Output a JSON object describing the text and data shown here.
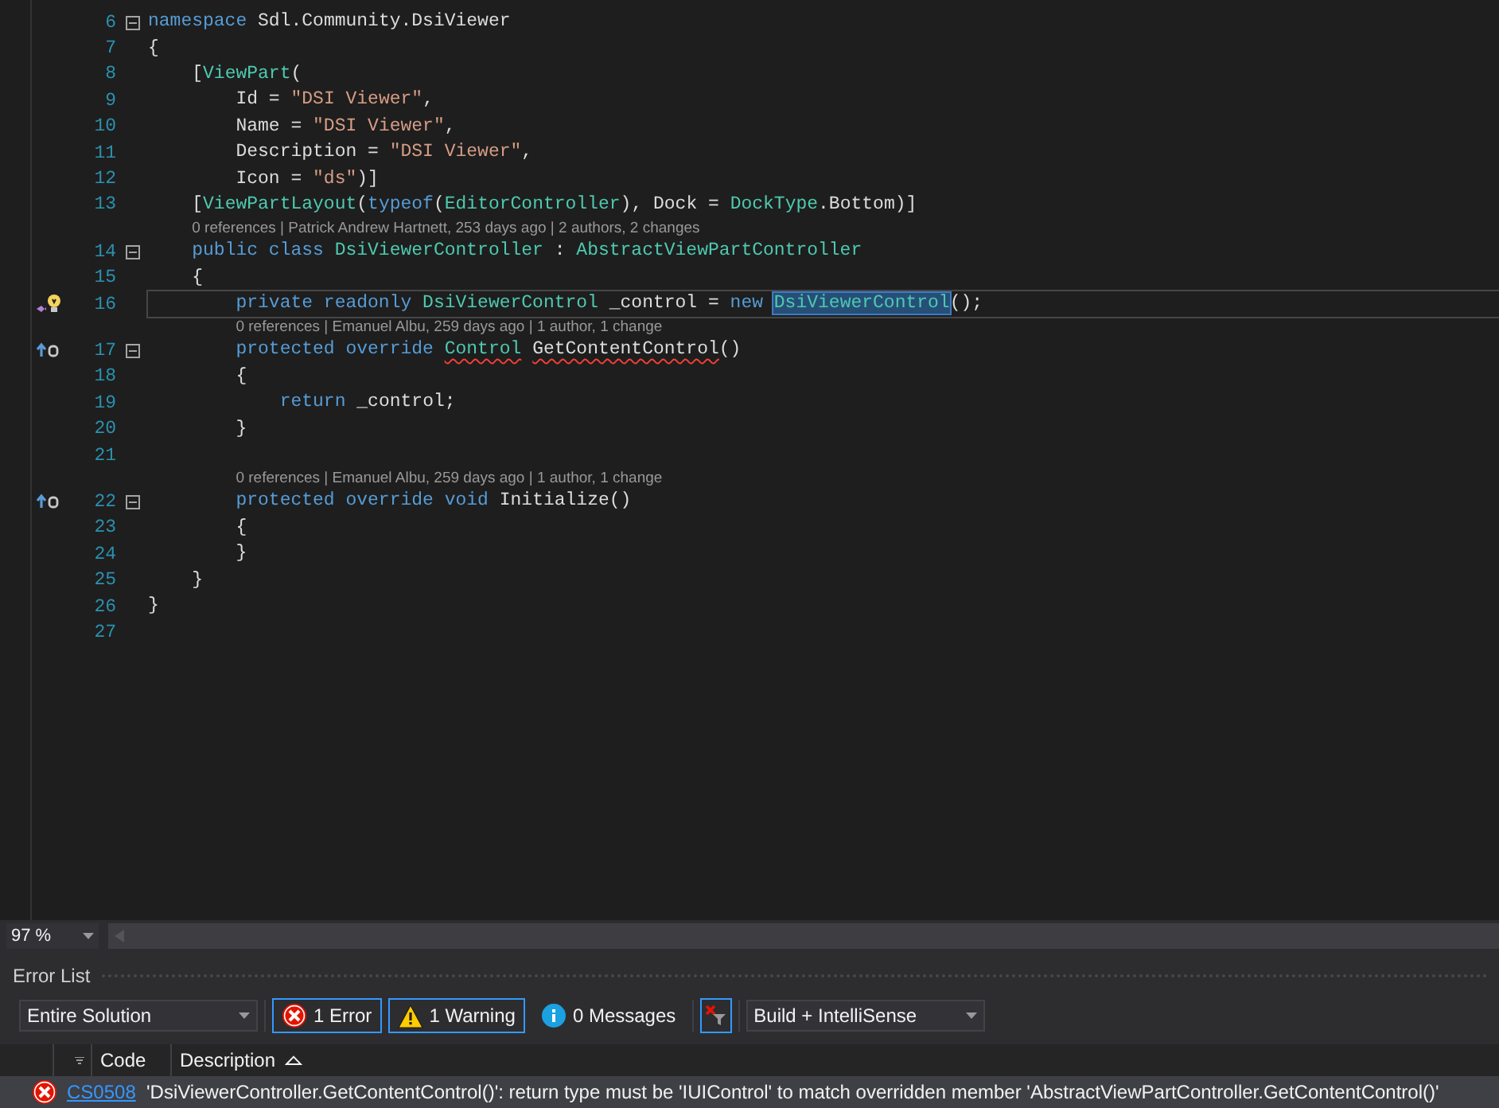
{
  "editor": {
    "lines": [
      {
        "number": "6",
        "fold": true,
        "tokens": [
          {
            "kind": "keyword",
            "text": "namespace"
          },
          {
            "kind": "text",
            "text": " Sdl.Community.DsiViewer"
          }
        ]
      },
      {
        "number": "7",
        "tokens": [
          {
            "kind": "text",
            "text": "{"
          }
        ]
      },
      {
        "number": "8",
        "tokens": [
          {
            "kind": "text",
            "text": "    ["
          },
          {
            "kind": "type",
            "text": "ViewPart"
          },
          {
            "kind": "text",
            "text": "("
          }
        ]
      },
      {
        "number": "9",
        "tokens": [
          {
            "kind": "text",
            "text": "        Id = "
          },
          {
            "kind": "string",
            "text": "\"DSI Viewer\""
          },
          {
            "kind": "text",
            "text": ","
          }
        ]
      },
      {
        "number": "10",
        "tokens": [
          {
            "kind": "text",
            "text": "        Name = "
          },
          {
            "kind": "string",
            "text": "\"DSI Viewer\""
          },
          {
            "kind": "text",
            "text": ","
          }
        ]
      },
      {
        "number": "11",
        "tokens": [
          {
            "kind": "text",
            "text": "        Description = "
          },
          {
            "kind": "string",
            "text": "\"DSI Viewer\""
          },
          {
            "kind": "text",
            "text": ","
          }
        ]
      },
      {
        "number": "12",
        "tokens": [
          {
            "kind": "text",
            "text": "        Icon = "
          },
          {
            "kind": "string",
            "text": "\"ds\""
          },
          {
            "kind": "text",
            "text": ")]"
          }
        ]
      },
      {
        "number": "13",
        "tokens": [
          {
            "kind": "text",
            "text": "    ["
          },
          {
            "kind": "type",
            "text": "ViewPartLayout"
          },
          {
            "kind": "text",
            "text": "("
          },
          {
            "kind": "keyword",
            "text": "typeof"
          },
          {
            "kind": "text",
            "text": "("
          },
          {
            "kind": "type",
            "text": "EditorController"
          },
          {
            "kind": "text",
            "text": "), Dock = "
          },
          {
            "kind": "type",
            "text": "DockType"
          },
          {
            "kind": "text",
            "text": ".Bottom)]"
          }
        ]
      },
      {
        "number": "14",
        "fold": true,
        "lens": "0 references | Patrick Andrew Hartnett, 253 days ago | 2 authors, 2 changes",
        "tokens": [
          {
            "kind": "keyword",
            "text": "    public class "
          },
          {
            "kind": "type",
            "text": "DsiViewerController"
          },
          {
            "kind": "text",
            "text": " : "
          },
          {
            "kind": "type",
            "text": "AbstractViewPartController"
          }
        ]
      },
      {
        "number": "15",
        "tokens": [
          {
            "kind": "text",
            "text": "    {"
          }
        ]
      },
      {
        "number": "16",
        "current": true,
        "marker": {
          "kind": "lightbulb"
        },
        "tokens": [
          {
            "kind": "keyword",
            "text": "        private readonly "
          },
          {
            "kind": "type",
            "text": "DsiViewerControl"
          },
          {
            "kind": "text",
            "text": " _control = "
          },
          {
            "kind": "keyword",
            "text": "new "
          },
          {
            "kind": "type-highlight",
            "text": "DsiViewerControl"
          },
          {
            "kind": "text",
            "text": "();"
          }
        ]
      },
      {
        "number": "17",
        "fold": true,
        "marker": {
          "kind": "override"
        },
        "lens": "0 references | Emanuel Albu, 259 days ago | 1 author, 1 change",
        "tokens": [
          {
            "kind": "keyword",
            "text": "        protected override "
          },
          {
            "kind": "type-squiggle",
            "text": "Control"
          },
          {
            "kind": "text-squiggle",
            "text": " GetContentControl"
          },
          {
            "kind": "text",
            "text": "()"
          }
        ]
      },
      {
        "number": "18",
        "tokens": [
          {
            "kind": "text",
            "text": "        {"
          }
        ]
      },
      {
        "number": "19",
        "tokens": [
          {
            "kind": "keyword",
            "text": "            return"
          },
          {
            "kind": "text",
            "text": " _control;"
          }
        ]
      },
      {
        "number": "20",
        "tokens": [
          {
            "kind": "text",
            "text": "        }"
          }
        ]
      },
      {
        "number": "21"
      },
      {
        "number": "22",
        "fold": true,
        "marker": {
          "kind": "override"
        },
        "lens": "0 references | Emanuel Albu, 259 days ago | 1 author, 1 change",
        "tokens": [
          {
            "kind": "keyword",
            "text": "        protected override void"
          },
          {
            "kind": "text",
            "text": " Initialize()"
          }
        ]
      },
      {
        "number": "23",
        "tokens": [
          {
            "kind": "text",
            "text": "        {"
          }
        ]
      },
      {
        "number": "24",
        "tokens": [
          {
            "kind": "text",
            "text": "        }"
          }
        ]
      },
      {
        "number": "25",
        "tokens": [
          {
            "kind": "text",
            "text": "    }"
          }
        ]
      },
      {
        "number": "26",
        "tokens": [
          {
            "kind": "text",
            "text": "}"
          }
        ]
      },
      {
        "number": "27"
      }
    ],
    "zoom": "97 %"
  },
  "error_list": {
    "title": "Error List",
    "scope": "Entire Solution",
    "filters": [
      {
        "kind": "error",
        "label": "1 Error",
        "selected": true
      },
      {
        "kind": "warning",
        "label": "1 Warning",
        "selected": true
      },
      {
        "kind": "info",
        "label": "0 Messages",
        "selected": false
      }
    ],
    "clear_filter_selected": true,
    "source": "Build + IntelliSense",
    "columns": [
      {
        "label": "Code"
      },
      {
        "label": "Description",
        "sorted": true
      }
    ],
    "rows": [
      {
        "kind": "error",
        "selected": true,
        "code": "CS0508",
        "description": "'DsiViewerController.GetContentControl()': return type must be 'IUIControl' to match overridden member 'AbstractViewPartController.GetContentControl()'"
      }
    ]
  }
}
